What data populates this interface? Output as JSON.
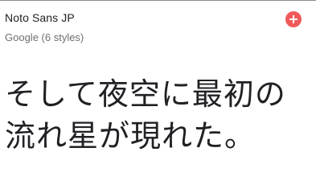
{
  "font_card": {
    "family_name": "Noto Sans JP",
    "meta": "Google (6 styles)",
    "add_icon": "plus-icon",
    "accent_color": "#f05a5a",
    "sample_lines": [
      "そして夜空に最初の",
      "流れ星が現れた。"
    ]
  }
}
